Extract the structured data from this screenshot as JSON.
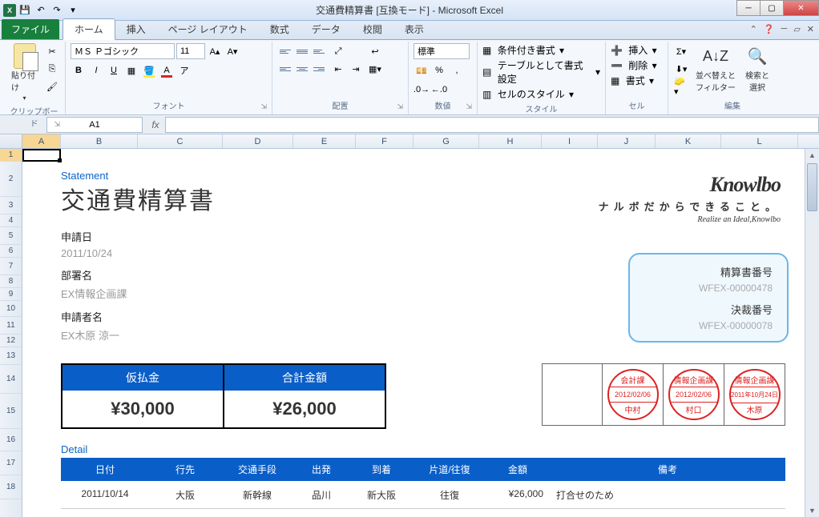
{
  "window": {
    "title": "交通費精算書 [互換モード] - Microsoft Excel"
  },
  "qat": {
    "save": "💾",
    "undo": "↶",
    "redo": "↷"
  },
  "tabs": {
    "file": "ファイル",
    "home": "ホーム",
    "insert": "挿入",
    "pagelayout": "ページ レイアウト",
    "formulas": "数式",
    "data": "データ",
    "review": "校閲",
    "view": "表示"
  },
  "ribbon": {
    "clipboard": {
      "label": "クリップボード",
      "paste": "貼り付け"
    },
    "font": {
      "label": "フォント",
      "face": "ＭＳ Ｐゴシック",
      "size": "11",
      "bold": "B",
      "italic": "I",
      "underline": "U"
    },
    "alignment": {
      "label": "配置"
    },
    "number": {
      "label": "数値",
      "format": "標準"
    },
    "styles": {
      "label": "スタイル",
      "conditional": "条件付き書式",
      "table": "テーブルとして書式設定",
      "cell": "セルのスタイル"
    },
    "cells": {
      "label": "セル",
      "insert": "挿入",
      "delete": "削除",
      "format": "書式"
    },
    "editing": {
      "label": "編集",
      "sort": "並べ替えと\nフィルター",
      "find": "検索と\n選択"
    }
  },
  "namebox": "A1",
  "columns": [
    "A",
    "B",
    "C",
    "D",
    "E",
    "F",
    "G",
    "H",
    "I",
    "J",
    "K",
    "L"
  ],
  "rows": [
    "1",
    "2",
    "3",
    "4",
    "5",
    "6",
    "7",
    "8",
    "9",
    "10",
    "11",
    "12",
    "13",
    "14",
    "15",
    "16",
    "17",
    "18"
  ],
  "doc": {
    "statement_label": "Statement",
    "title": "交通費精算書",
    "logo": {
      "brand": "Knowlbo",
      "sub1": "ナルボだからできること。",
      "sub2": "Realize an Ideal,Knowlbo"
    },
    "app_date": {
      "label": "申請日",
      "value": "2011/10/24"
    },
    "dept": {
      "label": "部署名",
      "value": "EX情報企画課"
    },
    "applicant": {
      "label": "申請者名",
      "value": "EX木原 涼一"
    },
    "infobox": {
      "num_label": "精算書番号",
      "num_value": "WFEX-00000478",
      "approval_label": "決裁番号",
      "approval_value": "WFEX-00000078"
    },
    "amounts": {
      "advance_label": "仮払金",
      "advance_value": "¥30,000",
      "total_label": "合計金額",
      "total_value": "¥26,000"
    },
    "stamps": [
      {
        "dept": "会計課",
        "date": "2012/02/06",
        "name": "中村"
      },
      {
        "dept": "情報企画課",
        "date": "2012/02/06",
        "name": "村口"
      },
      {
        "dept": "情報企画課",
        "date": "2011年10月24日",
        "name": "木原"
      }
    ],
    "detail_label": "Detail",
    "detail_headers": [
      "日付",
      "行先",
      "交通手段",
      "出発",
      "到着",
      "片道/往復",
      "金額",
      "備考"
    ],
    "detail_rows": [
      [
        "2011/10/14",
        "大阪",
        "新幹線",
        "品川",
        "新大阪",
        "往復",
        "¥26,000",
        "打合せのため"
      ]
    ]
  }
}
